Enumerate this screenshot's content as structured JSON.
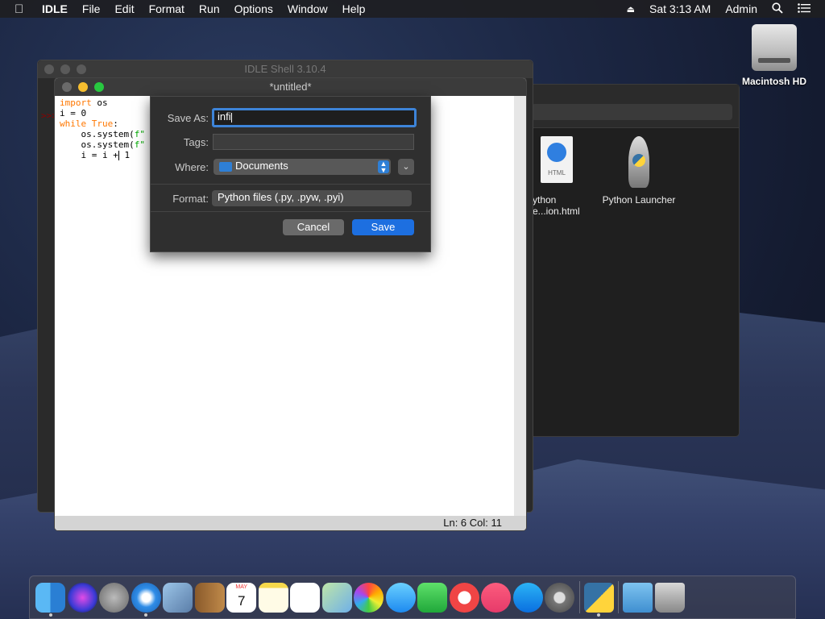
{
  "menubar": {
    "app": "IDLE",
    "items": [
      "File",
      "Edit",
      "Format",
      "Run",
      "Options",
      "Window",
      "Help"
    ],
    "clock": "Sat 3:13 AM",
    "user": "Admin"
  },
  "desktop": {
    "hd_label": "Macintosh HD"
  },
  "finder": {
    "items": [
      {
        "label_line1": "ython",
        "label_line2": "e...ion.html",
        "badge": "HTML"
      },
      {
        "label": "Python Launcher"
      }
    ]
  },
  "shell": {
    "title": "IDLE Shell 3.10.4",
    "prompt": ">>>"
  },
  "editor": {
    "title": "*untitled*",
    "status": "Ln: 6   Col: 11"
  },
  "save_dialog": {
    "save_as_label": "Save As:",
    "save_as_value": "infi",
    "tags_label": "Tags:",
    "where_label": "Where:",
    "where_value": "Documents",
    "format_label": "Format:",
    "format_value": "Python files (.py, .pyw, .pyi)",
    "cancel": "Cancel",
    "save": "Save"
  },
  "dock": {
    "apps": [
      "finder-icon",
      "siri-icon",
      "launchpad-icon",
      "safari-icon",
      "mail-icon",
      "contacts-icon",
      "calendar-icon",
      "notes-icon",
      "reminders-icon",
      "maps-icon",
      "photos-icon",
      "messages-icon",
      "facetime-icon",
      "news-icon",
      "music-icon",
      "app-store-icon",
      "system-preferences-icon",
      "python-launcher-icon",
      "downloads-icon",
      "trash-icon"
    ],
    "calendar_month": "MAY",
    "calendar_day": "7"
  },
  "colors": {
    "accent": "#1d6fe0",
    "keyword": "#ff7700",
    "string": "#00aa00"
  }
}
